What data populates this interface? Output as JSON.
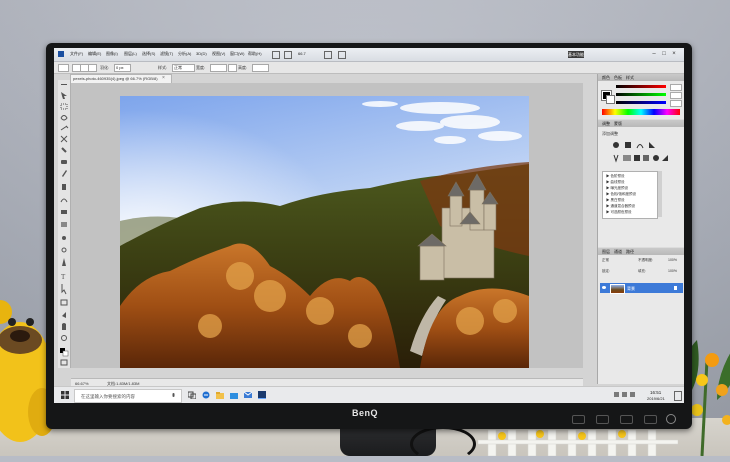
{
  "photoshop": {
    "menu": [
      "文件(F)",
      "编辑(E)",
      "图像(I)",
      "图层(L)",
      "选择(S)",
      "滤镜(T)",
      "分析(A)",
      "3D(D)",
      "视图(V)",
      "窗口(W)",
      "帮助(H)"
    ],
    "zoom_dropdown": "66.7",
    "workspace_button": "基本功能",
    "options": {
      "feather_label": "羽化:",
      "feather_value": "0 px",
      "style_label": "样式:",
      "style_value": "正常",
      "width_label": "宽度:",
      "height_label": "高度:"
    },
    "document_tab": "pexels-photo-460935(4).jpeg @ 66.7% (RGB/8)",
    "status_zoom": "66.67%",
    "status_doc": "文档:1.83M/1.83M",
    "adjustments": {
      "tabs": [
        "调整",
        "蒙版"
      ],
      "title": "添加调整",
      "presets": [
        "▶ 色阶预设",
        "▶ 曲线预设",
        "▶ 曝光度预设",
        "▶ 色相/饱和度预设",
        "▶ 黑白预设",
        "▶ 通道混合器预设",
        "▶ 可选颜色预设"
      ]
    },
    "layers": {
      "tabs": [
        "图层",
        "通道",
        "路径"
      ],
      "blend_mode": "正常",
      "opacity_label": "不透明度:",
      "opacity_value": "100%",
      "lock_label": "锁定:",
      "fill_label": "填充:",
      "fill_value": "100%",
      "layer_name": "背景"
    },
    "color_panel_tabs": [
      "颜色",
      "色板",
      "样式"
    ]
  },
  "taskbar": {
    "search_placeholder": "在这里输入你要搜索的内容",
    "time": "16:51",
    "date": "2019/6/21"
  },
  "monitor": {
    "brand": "BenQ"
  },
  "icons": [
    "windows-start-icon",
    "search-icon",
    "task-view-icon",
    "edge-icon",
    "file-explorer-icon",
    "store-icon",
    "mail-icon",
    "photoshop-icon"
  ]
}
